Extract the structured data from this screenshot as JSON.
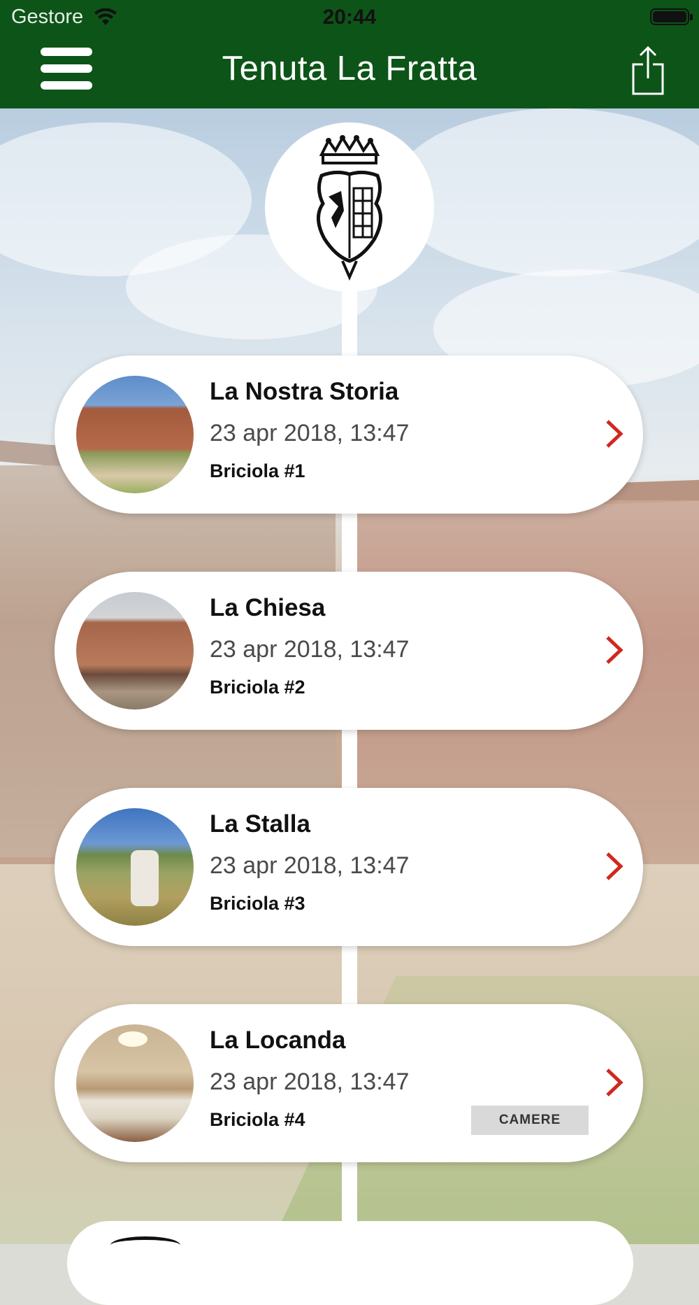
{
  "status": {
    "carrier": "Gestore",
    "time": "20:44",
    "battery_level": 1.0
  },
  "header": {
    "title": "Tenuta La Fratta",
    "menu_icon": "hamburger-menu-icon",
    "share_icon": "share-icon"
  },
  "theme": {
    "header_green": "#0d5418",
    "chevron_red": "#d0281e"
  },
  "crest": {
    "icon": "coat-of-arms-icon"
  },
  "items": [
    {
      "title": "La Nostra Storia",
      "date": "23 apr 2018, 13:47",
      "subtitle": "Briciola #1",
      "image": "farm-building-photo"
    },
    {
      "title": "La Chiesa",
      "date": "23 apr 2018, 13:47",
      "subtitle": "Briciola #2",
      "image": "church-photo"
    },
    {
      "title": "La Stalla",
      "date": "23 apr 2018, 13:47",
      "subtitle": "Briciola #3",
      "image": "cattle-field-photo"
    },
    {
      "title": "La Locanda",
      "date": "23 apr 2018, 13:47",
      "subtitle": "Briciola #4",
      "image": "bedroom-photo",
      "tag": "CAMERE"
    }
  ]
}
